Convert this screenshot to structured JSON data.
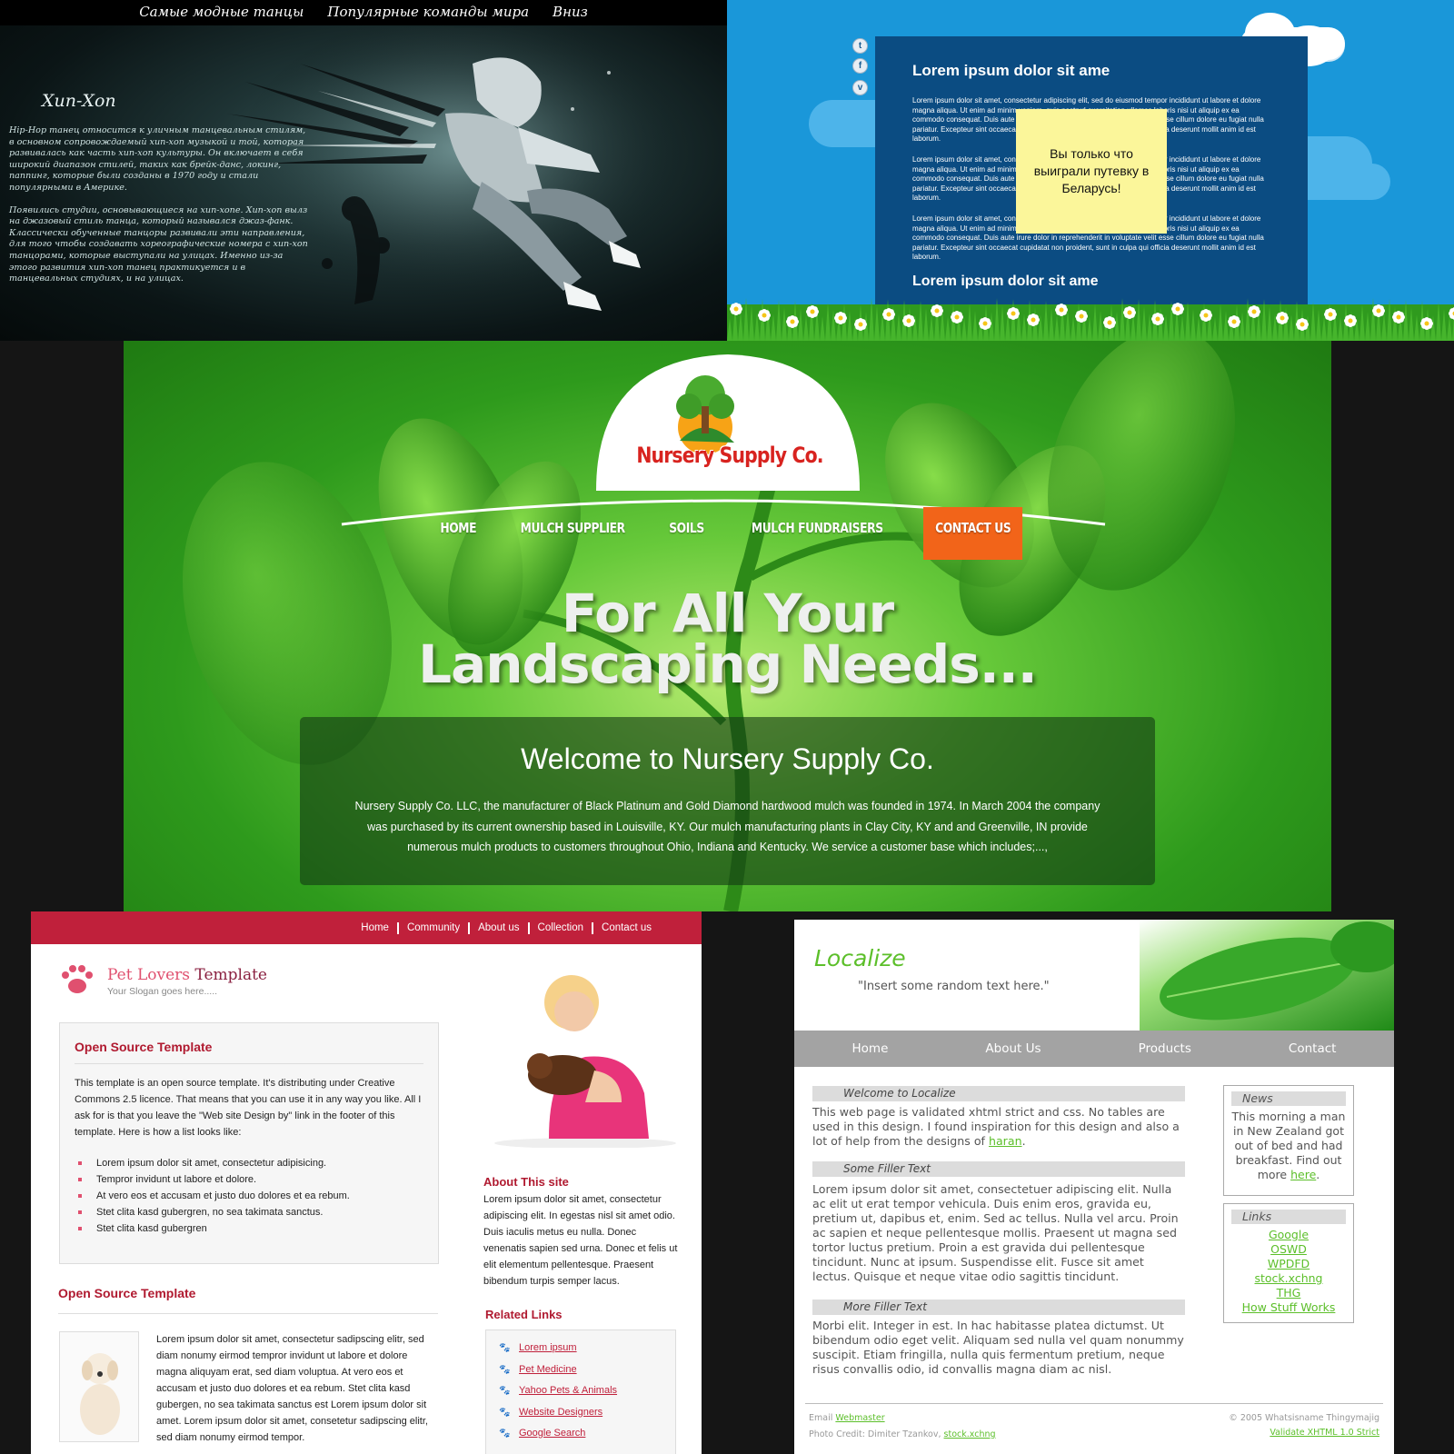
{
  "hiphop": {
    "nav": [
      "Самые модные танцы",
      "Популярные команды мира",
      "Вниз"
    ],
    "title": "Хип-Хоп",
    "paragraphs": [
      "Hip-Hop танец относится к уличным танцевальным стилям, в основном сопровождаемый хип-хоп музыкой и той, которая развивалась как часть хип-хоп культуры. Он включает в себя широкий диапазон стилей, таких как брейк-данс, локинг, паппинг, которые были созданы в 1970 году и стали популярными в Америке.",
      "Появились студии, основывающиеся на хип-хопе. Хип-хоп вылз на джазовый стиль танца, который назывался джаз-фанк. Классически обученные танцоры развивали эти направления, для того чтобы создавать хореографические номера с хип-хоп танцорами, которые выступали на улицах. Именно из-за этого развития хип-хоп танец практикуется и в танцевальных студиях, и на улицах."
    ]
  },
  "sky": {
    "heading": "Lorem ipsum dolor sit ame",
    "paragraphs": [
      "Lorem ipsum dolor sit amet, consectetur adipiscing elit, sed do eiusmod tempor incididunt ut labore et dolore magna aliqua. Ut enim ad minim veniam, quis nostrud exercitation ullamco laboris nisi ut aliquip ex ea commodo consequat. Duis aute irure dolor in reprehenderit in voluptate velit esse cillum dolore eu fugiat nulla pariatur. Excepteur sint occaecat cupidatat non proident, sunt in culpa qui officia deserunt mollit anim id est laborum.",
      "Lorem ipsum dolor sit amet, consectetur adipiscing elit, sed do eiusmod tempor incididunt ut labore et dolore magna aliqua. Ut enim ad minim veniam, quis nostrud exercitation ullamco laboris nisi ut aliquip ex ea commodo consequat. Duis aute irure dolor in reprehenderit in voluptate velit esse cillum dolore eu fugiat nulla pariatur. Excepteur sint occaecat cupidatat non proident, sunt in culpa qui officia deserunt mollit anim id est laborum.",
      "Lorem ipsum dolor sit amet, consectetur adipiscing elit, sed do eiusmod tempor incididunt ut labore et dolore magna aliqua. Ut enim ad minim veniam, quis nostrud exercitation ullamco laboris nisi ut aliquip ex ea commodo consequat. Duis aute irure dolor in reprehenderit in voluptate velit esse cillum dolore eu fugiat nulla pariatur. Excepteur sint occaecat cupidatat non proident, sunt in culpa qui officia deserunt mollit anim id est laborum."
    ],
    "heading2": "Lorem ipsum dolor sit ame",
    "note": "Вы только что выиграли путевку в Беларусь!",
    "social_icons": [
      "twitter-icon",
      "facebook-icon",
      "vimeo-icon"
    ]
  },
  "nursery": {
    "logo_text": "Nursery Supply Co.",
    "nav": [
      "HOME",
      "MULCH SUPPLIER",
      "SOILS",
      "MULCH FUNDRAISERS",
      "CONTACT US"
    ],
    "active_nav": "CONTACT US",
    "headline_1": "For All Your",
    "headline_2": "Landscaping Needs...",
    "welcome_title": "Welcome to Nursery Supply Co.",
    "welcome_text": "Nursery Supply Co. LLC, the manufacturer of Black Platinum and Gold Diamond hardwood mulch was founded in 1974. In March 2004 the company was purchased by its current ownership based in Louisville, KY. Our mulch manufacturing plants in Clay City, KY and and Greenville, IN provide numerous mulch products to customers throughout Ohio, Indiana and Kentucky. We service a customer base which includes;...,",
    "accent": "#f26419"
  },
  "pets": {
    "nav": [
      "Home",
      "Community",
      "About us",
      "Collection",
      "Contact us"
    ],
    "logo_a": "Pet Lovers",
    "logo_b": " Template",
    "slogan": "Your Slogan goes here.....",
    "box_title": "Open Source Template",
    "box_text": "This template is an open source template. It's distributing under Creative Commons 2.5 licence. That means that you can use it in any way you like. All I ask for is that you leave the \"Web site Design by\" link in the footer of this template. Here is how a list looks like:",
    "list": [
      "Lorem ipsum dolor sit amet, consectetur adipisicing.",
      "Tempror invidunt ut labore et dolore.",
      "At vero eos et accusam et justo duo dolores et ea rebum.",
      "Stet clita kasd gubergren, no sea takimata sanctus.",
      "Stet clita kasd gubergren"
    ],
    "section_title": "Open Source Template",
    "section_text": "Lorem ipsum dolor sit amet, consectetur sadipscing elitr, sed diam nonumy eirmod tempror invidunt ut labore et dolore magna aliquyam erat, sed diam voluptua. At vero eos et accusam et justo duo dolores et ea rebum. Stet clita kasd gubergen, no sea takimata sanctus est Lorem ipsum dolor sit amet. Lorem ipsum dolor sit amet, consetetur sadipscing elitr, sed diam nonumy eirmod tempor.",
    "about_title": "About This site",
    "about_text": "Lorem ipsum dolor sit amet, consectetur adipiscing elit. In egestas nisl sit amet odio. Duis iaculis metus eu nulla. Donec venenatis sapien sed urna. Donec et felis ut elit elementum pellentesque. Praesent bibendum turpis semper lacus.",
    "related_title": "Related Links",
    "related": [
      "Lorem ipsum",
      "Pet Medicine",
      "Yahoo Pets & Animals",
      "Website Designers",
      "Google Search"
    ],
    "brand_color": "#c0203b"
  },
  "localize": {
    "title": "Localize",
    "quote": "\"Insert some random text here.\"",
    "nav": [
      "Home",
      "About Us",
      "Products",
      "Contact"
    ],
    "s1_title": "Welcome to Localize",
    "s1_text": "This web page is validated xhtml strict and css. No tables are used in this design. I found inspiration for this design and also a lot of help from the designs of ",
    "s1_link": "haran",
    "s2_title": "Some Filler Text",
    "s2_text": "Lorem ipsum dolor sit amet, consectetuer adipiscing elit. Nulla ac elit ut erat tempor vehicula. Duis enim eros, gravida eu, pretium ut, dapibus et, enim. Sed ac tellus. Nulla vel arcu. Proin ac sapien et neque pellentesque mollis. Praesent ut magna sed tortor luctus pretium. Proin a est gravida dui pellentesque tincidunt. Nunc at ipsum. Suspendisse elit. Fusce sit amet lectus. Quisque et neque vitae odio sagittis tincidunt.",
    "s3_title": "More Filler Text",
    "s3_text": "Morbi elit. Integer in est. In hac habitasse platea dictumst. Ut bibendum odio eget velit. Aliquam sed nulla vel quam nonummy suscipit. Etiam fringilla, nulla quis fermentum pretium, neque risus convallis odio, id convallis magna diam ac nisl.",
    "news_title": "News",
    "news_text": "This morning a man in New Zealand got out of bed and had breakfast. Find out more ",
    "news_link": "here",
    "links_title": "Links",
    "links": [
      "Google",
      "OSWD",
      "WPDFD",
      "stock.xchng",
      "THG",
      "How Stuff Works"
    ],
    "footer_email_label": "Email ",
    "footer_email_link": "Webmaster",
    "footer_credit_label": "Photo Credit: Dimiter Tzankov, ",
    "footer_credit_link": "stock.xchng",
    "footer_copyright": "© 2005 Whatsisname Thingymajig",
    "footer_validate": "Validate XHTML 1.0 Strict",
    "accent": "#5cbf2a"
  }
}
